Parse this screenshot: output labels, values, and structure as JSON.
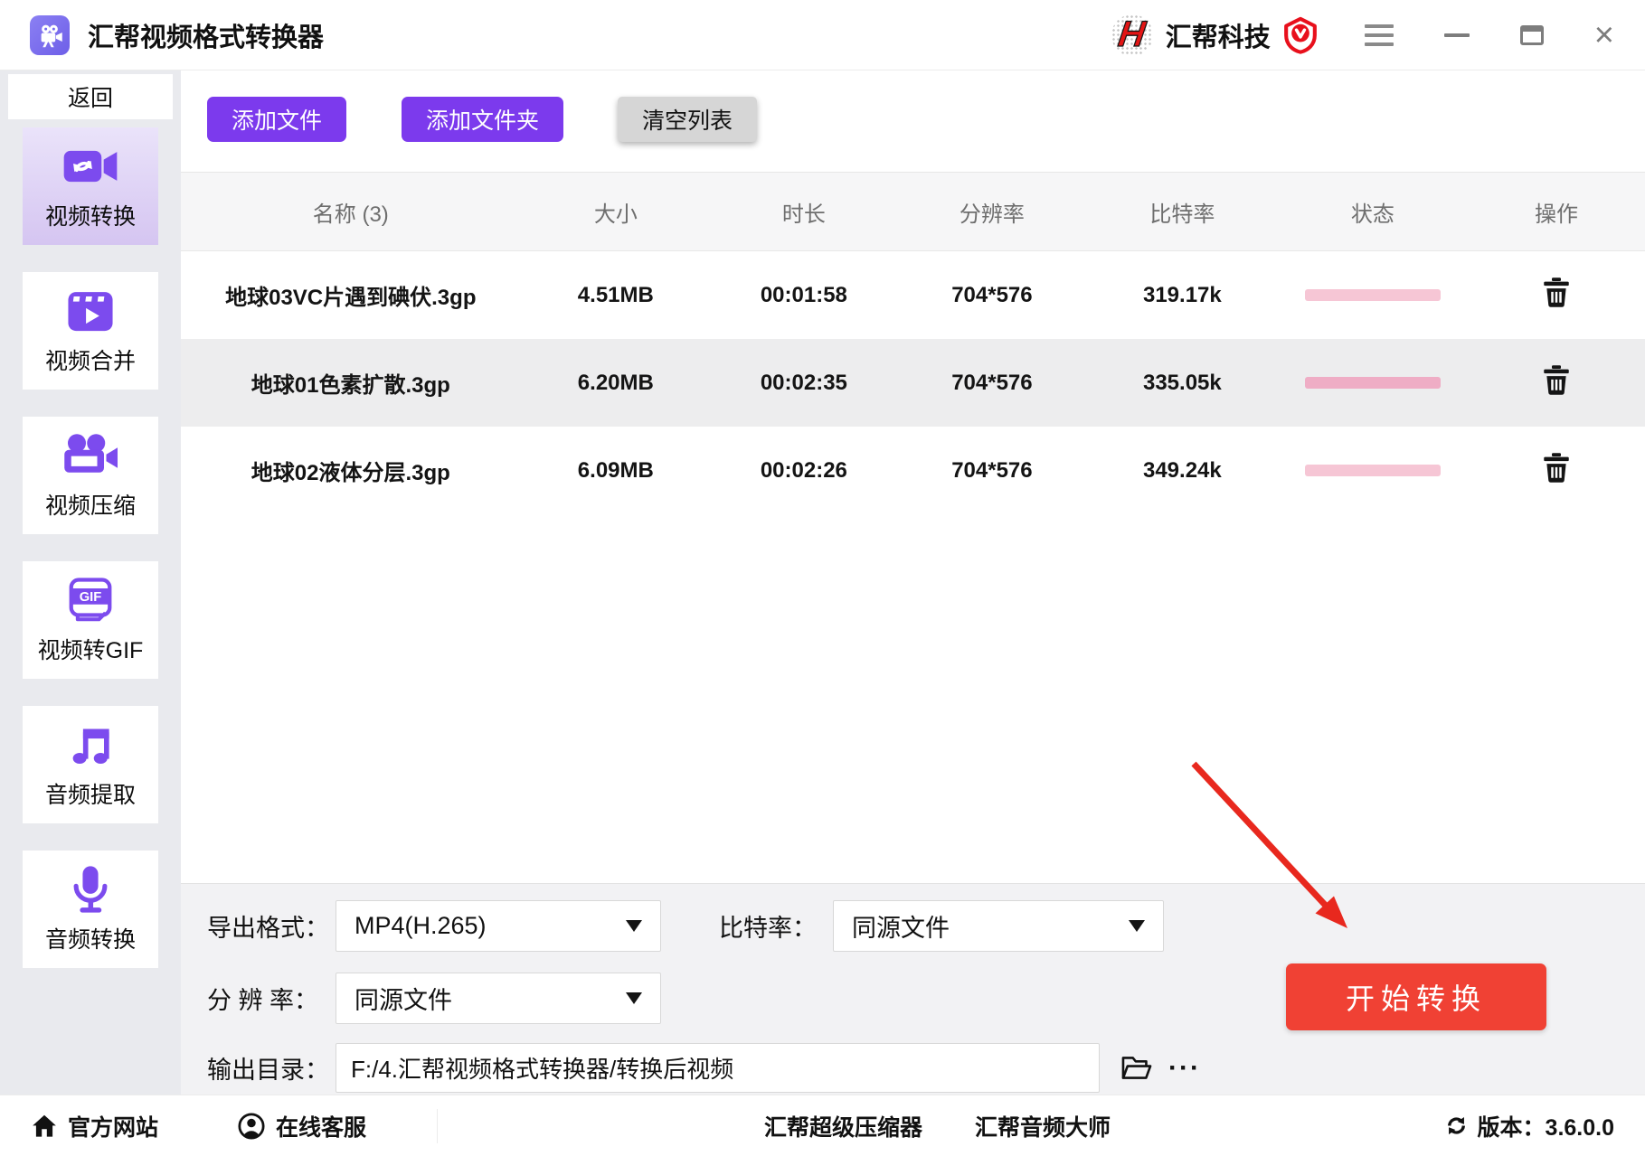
{
  "window": {
    "app_title": "汇帮视频格式转换器",
    "brand_name": "汇帮科技"
  },
  "sidebar": {
    "back_label": "返回",
    "items": [
      {
        "label": "视频转换",
        "icon": "video-convert-icon",
        "active": true
      },
      {
        "label": "视频合并",
        "icon": "video-merge-icon",
        "active": false
      },
      {
        "label": "视频压缩",
        "icon": "video-compress-icon",
        "active": false
      },
      {
        "label": "视频转GIF",
        "icon": "video-to-gif-icon",
        "active": false
      },
      {
        "label": "音频提取",
        "icon": "audio-extract-icon",
        "active": false
      },
      {
        "label": "音频转换",
        "icon": "audio-convert-icon",
        "active": false
      }
    ]
  },
  "toolbar": {
    "add_file": "添加文件",
    "add_folder": "添加文件夹",
    "clear_list": "清空列表"
  },
  "table": {
    "headers": [
      "名称 (3)",
      "大小",
      "时长",
      "分辨率",
      "比特率",
      "状态",
      "操作"
    ],
    "rows": [
      {
        "name": "地球03VC片遇到碘伏.3gp",
        "size": "4.51MB",
        "duration": "00:01:58",
        "resolution": "704*576",
        "bitrate": "319.17k",
        "bar_color": "#f6c6d5"
      },
      {
        "name": "地球01色素扩散.3gp",
        "size": "6.20MB",
        "duration": "00:02:35",
        "resolution": "704*576",
        "bitrate": "335.05k",
        "bar_color": "#efadc5"
      },
      {
        "name": "地球02液体分层.3gp",
        "size": "6.09MB",
        "duration": "00:02:26",
        "resolution": "704*576",
        "bitrate": "349.24k",
        "bar_color": "#f6c6d5"
      }
    ]
  },
  "settings": {
    "export_format_label": "导出格式：",
    "export_format_value": "MP4(H.265)",
    "bitrate_label": "比特率：",
    "bitrate_value": "同源文件",
    "resolution_label": "分 辨 率：",
    "resolution_value": "同源文件",
    "output_dir_label": "输出目录：",
    "output_dir_value": "F:/4.汇帮视频格式转换器/转换后视频",
    "more_label": "···",
    "start_label": "开始转换"
  },
  "footer": {
    "official_site": "官方网站",
    "online_service": "在线客服",
    "link1": "汇帮超级压缩器",
    "link2": "汇帮音频大师",
    "version": "版本：3.6.0.0"
  },
  "colors": {
    "accent_purple": "#7c3aed",
    "icon_purple": "#7c4bee",
    "start_red": "#f04134",
    "arrow_red": "#e8281e",
    "progress_pink_light": "#f6c6d5",
    "progress_pink_dark": "#efadc5"
  }
}
